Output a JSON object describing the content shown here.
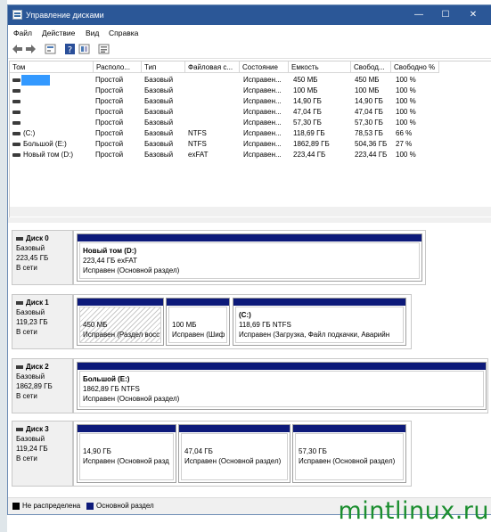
{
  "window": {
    "title": "Управление дисками",
    "minimize": "—",
    "maximize": "☐",
    "close": "✕"
  },
  "menu": [
    "Файл",
    "Действие",
    "Вид",
    "Справка"
  ],
  "toolbar_icons": [
    "back-arrow-icon",
    "forward-arrow-icon",
    "properties-icon",
    "help-icon",
    "view-icon",
    "settings-icon"
  ],
  "volume_list": {
    "columns": [
      "Том",
      "Располо...",
      "Тип",
      "Файловая с...",
      "Состояние",
      "Емкость",
      "Свобод...",
      "Свободно %"
    ],
    "rows": [
      {
        "name": "",
        "layout": "Простой",
        "type": "Базовый",
        "fs": "",
        "status": "Исправен...",
        "capacity": "450 МБ",
        "free": "450 МБ",
        "free_pct": "100 %",
        "selected": true
      },
      {
        "name": "",
        "layout": "Простой",
        "type": "Базовый",
        "fs": "",
        "status": "Исправен...",
        "capacity": "100 МБ",
        "free": "100 МБ",
        "free_pct": "100 %"
      },
      {
        "name": "",
        "layout": "Простой",
        "type": "Базовый",
        "fs": "",
        "status": "Исправен...",
        "capacity": "14,90 ГБ",
        "free": "14,90 ГБ",
        "free_pct": "100 %"
      },
      {
        "name": "",
        "layout": "Простой",
        "type": "Базовый",
        "fs": "",
        "status": "Исправен...",
        "capacity": "47,04 ГБ",
        "free": "47,04 ГБ",
        "free_pct": "100 %"
      },
      {
        "name": "",
        "layout": "Простой",
        "type": "Базовый",
        "fs": "",
        "status": "Исправен...",
        "capacity": "57,30 ГБ",
        "free": "57,30 ГБ",
        "free_pct": "100 %"
      },
      {
        "name": "(C:)",
        "layout": "Простой",
        "type": "Базовый",
        "fs": "NTFS",
        "status": "Исправен...",
        "capacity": "118,69 ГБ",
        "free": "78,53 ГБ",
        "free_pct": "66 %"
      },
      {
        "name": "Большой (E:)",
        "layout": "Простой",
        "type": "Базовый",
        "fs": "NTFS",
        "status": "Исправен...",
        "capacity": "1862,89 ГБ",
        "free": "504,36 ГБ",
        "free_pct": "27 %"
      },
      {
        "name": "Новый том (D:)",
        "layout": "Простой",
        "type": "Базовый",
        "fs": "exFAT",
        "status": "Исправен...",
        "capacity": "223,44 ГБ",
        "free": "223,44 ГБ",
        "free_pct": "100 %"
      }
    ]
  },
  "disks": [
    {
      "name": "Диск 0",
      "type": "Базовый",
      "size": "223,45 ГБ",
      "state": "В сети",
      "partitions": [
        {
          "title": "Новый том  (D:)",
          "line1": "223,44 ГБ exFAT",
          "line2": "Исправен (Основной раздел)"
        }
      ]
    },
    {
      "name": "Диск 1",
      "type": "Базовый",
      "size": "119,23 ГБ",
      "state": "В сети",
      "partitions": [
        {
          "title": "",
          "line1": "450 МБ",
          "line2": "Исправен (Раздел восс"
        },
        {
          "title": "",
          "line1": "100 МБ",
          "line2": "Исправен (Шиф"
        },
        {
          "title": "(C:)",
          "line1": "118,69 ГБ NTFS",
          "line2": "Исправен (Загрузка, Файл подкачки, Аварийн"
        }
      ]
    },
    {
      "name": "Диск 2",
      "type": "Базовый",
      "size": "1862,89 ГБ",
      "state": "В сети",
      "partitions": [
        {
          "title": "Большой  (E:)",
          "line1": "1862,89 ГБ NTFS",
          "line2": "Исправен (Основной раздел)"
        }
      ]
    },
    {
      "name": "Диск 3",
      "type": "Базовый",
      "size": "119,24 ГБ",
      "state": "В сети",
      "partitions": [
        {
          "title": "",
          "line1": "14,90 ГБ",
          "line2": "Исправен (Основной разд"
        },
        {
          "title": "",
          "line1": "47,04 ГБ",
          "line2": "Исправен (Основной раздел)"
        },
        {
          "title": "",
          "line1": "57,30 ГБ",
          "line2": "Исправен (Основной раздел)"
        }
      ]
    }
  ],
  "legend": [
    {
      "label": "Не распределена",
      "color": "#000000"
    },
    {
      "label": "Основной раздел",
      "color": "#0d1a7a"
    }
  ],
  "watermark": "mintlinux.ru",
  "colors": {
    "titlebar": "#2b5797",
    "selection": "#3399ff",
    "partition_bar": "#0d1a7a",
    "watermark": "#1b8e2f"
  }
}
